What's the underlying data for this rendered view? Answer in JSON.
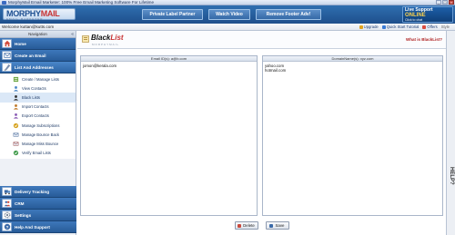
{
  "window": {
    "title": "MorphyMail Email Marketer: 100% Free Email Marketing Software For Lifetime",
    "controls": [
      "_",
      "□",
      "×"
    ]
  },
  "header": {
    "logo_main": "MORPHY",
    "logo_accent": "MAIL",
    "logo_sub": "EMAIL MARKETER",
    "buttons": [
      "Private Label Partner",
      "Watch Video",
      "Remove Footer Adv!"
    ],
    "live_support": {
      "line1": "Live Support",
      "line2": "ONLINE",
      "line3": "Click to chat"
    }
  },
  "subbar": {
    "welcome": "Welcome  kuttan@kutts.com",
    "links": [
      "Upgrade",
      "Quick Start Tutorial",
      "Offers",
      "Style"
    ]
  },
  "sidebar": {
    "heading": "Navigation",
    "collapse": "«",
    "top_items": [
      "Home",
      "Create an Email",
      "List And Addresses"
    ],
    "sub_items": [
      "Create / Manage Lists",
      "View Contacts",
      "Black Lists",
      "Import Contacts",
      "Export Contacts",
      "Manage Subscriptions",
      "Manage Bounce Back",
      "Manage Miss Bounce",
      "Verify Email Lists"
    ],
    "bottom_items": [
      "Delivery Tracking",
      "CRM",
      "Settings",
      "Help And Support"
    ]
  },
  "page": {
    "title_black": "Black",
    "title_red": "List",
    "subtitle": "MORPHYMAIL",
    "help_link": "What is BlackList?"
  },
  "email_panel": {
    "header": "Email ID(s): a@b.com",
    "entries": [
      "jomon@kerala.com"
    ]
  },
  "domain_panel": {
    "header": "DomainName(s): xyz.com",
    "entries": [
      "yahoo.com",
      "hotmail.com"
    ]
  },
  "actions": {
    "delete": "Delete",
    "save": "Save"
  },
  "help_tab": "HELP?",
  "colors": {
    "header_blue": "#275b98",
    "accent_red": "#c72f2f",
    "panel_border": "#a9b6c9"
  }
}
